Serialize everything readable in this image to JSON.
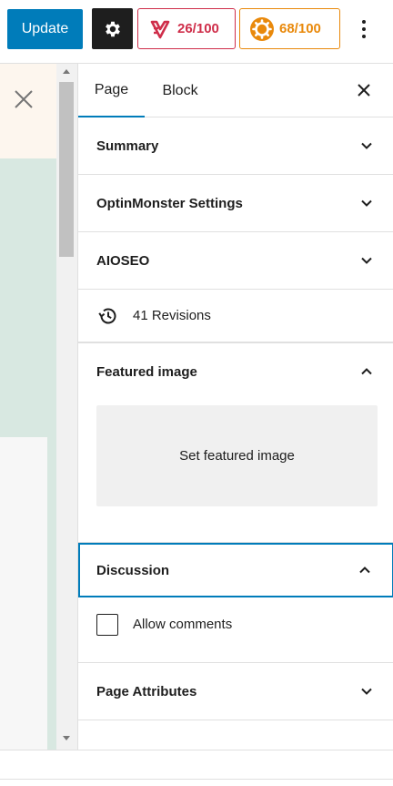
{
  "toolbar": {
    "update_label": "Update",
    "settings_icon": "gear-icon",
    "readability_score": "26/100",
    "readability_color": "#cf2e4a",
    "seo_score": "68/100",
    "seo_color": "#e9890b",
    "more_icon": "vertical-ellipsis-icon"
  },
  "sidebar": {
    "tabs": [
      {
        "label": "Page",
        "active": true
      },
      {
        "label": "Block",
        "active": false
      }
    ],
    "panels": {
      "summary": {
        "title": "Summary",
        "expanded": false
      },
      "optinmonster": {
        "title": "OptinMonster Settings",
        "expanded": false
      },
      "aioseo": {
        "title": "AIOSEO",
        "expanded": false
      },
      "revisions": {
        "label": "41 Revisions"
      },
      "featured_image": {
        "title": "Featured image",
        "expanded": true,
        "button": "Set featured image"
      },
      "discussion": {
        "title": "Discussion",
        "expanded": true,
        "allow_comments_label": "Allow comments",
        "allow_comments_checked": false
      },
      "page_attributes": {
        "title": "Page Attributes",
        "expanded": false
      }
    }
  },
  "colors": {
    "accent": "#007cba",
    "notice_bg": "#fdf6ee",
    "canvas_bg": "#d8e8e1"
  }
}
